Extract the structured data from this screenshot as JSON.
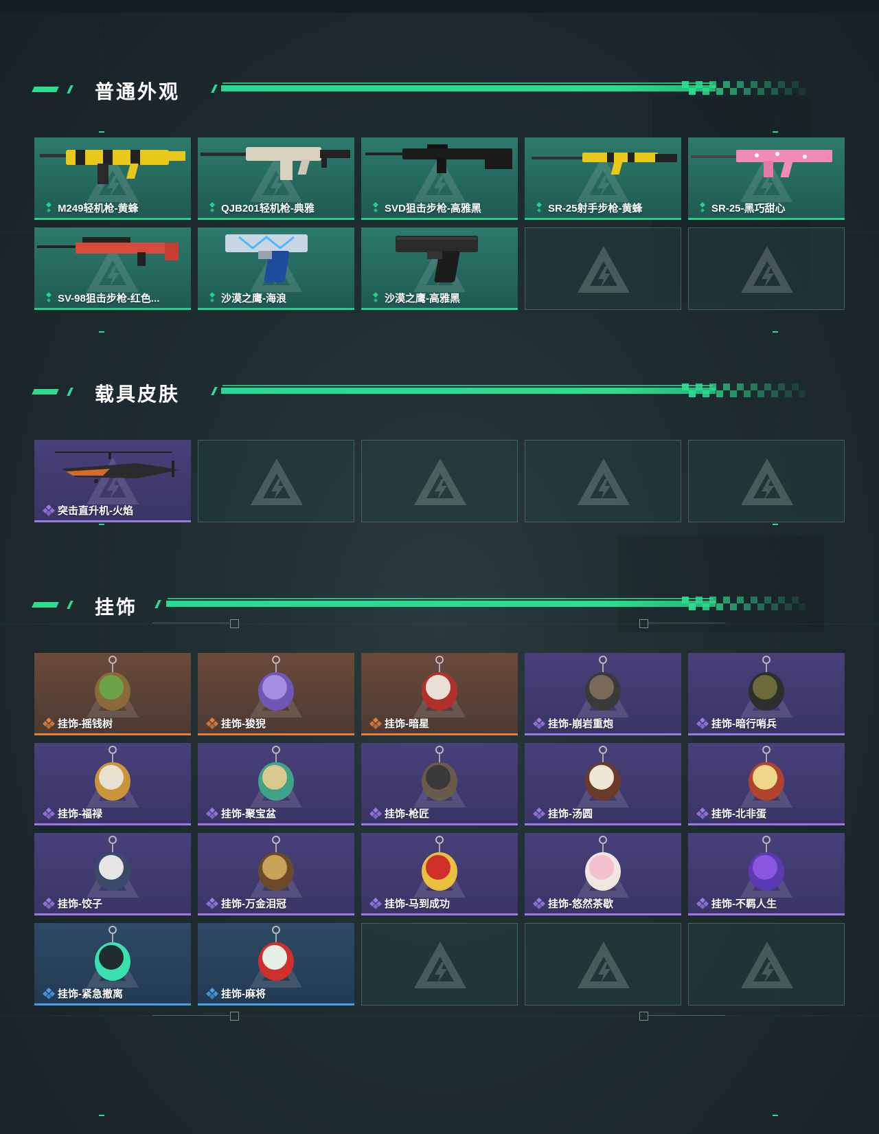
{
  "sections": [
    {
      "title": "普通外观",
      "items": [
        {
          "label": "M249轻机枪-黄蜂",
          "rarity": "green",
          "icon": "machine-gun-icon"
        },
        {
          "label": "QJB201轻机枪-典雅",
          "rarity": "green",
          "icon": "light-machine-gun-icon"
        },
        {
          "label": "SVD狙击步枪-高雅黑",
          "rarity": "green",
          "icon": "sniper-rifle-icon"
        },
        {
          "label": "SR-25射手步枪-黄蜂",
          "rarity": "green",
          "icon": "marksman-rifle-icon"
        },
        {
          "label": "SR-25-黑巧甜心",
          "rarity": "green",
          "icon": "marksman-rifle-pink-icon"
        },
        {
          "label": "SV-98狙击步枪-红色...",
          "rarity": "green",
          "icon": "sniper-rifle-red-icon"
        },
        {
          "label": "沙漠之鹰-海浪",
          "rarity": "green",
          "icon": "pistol-blue-icon"
        },
        {
          "label": "沙漠之鹰-高雅黑",
          "rarity": "green",
          "icon": "pistol-black-icon"
        }
      ],
      "empty_slots": 2
    },
    {
      "title": "载具皮肤",
      "items": [
        {
          "label": "突击直升机-火焰",
          "rarity": "purple",
          "icon": "helicopter-icon"
        }
      ],
      "empty_slots": 4
    },
    {
      "title": "挂饰",
      "items": [
        {
          "label": "挂饰-摇钱树",
          "rarity": "orange",
          "icon": "money-tree-charm-icon"
        },
        {
          "label": "挂饰-狻猊",
          "rarity": "orange",
          "icon": "suanni-charm-icon"
        },
        {
          "label": "挂饰-暗星",
          "rarity": "orange",
          "icon": "dark-star-charm-icon"
        },
        {
          "label": "挂饰-崩岩重炮",
          "rarity": "purple",
          "icon": "rock-cannon-charm-icon"
        },
        {
          "label": "挂饰-暗行哨兵",
          "rarity": "purple",
          "icon": "sentinel-charm-icon"
        },
        {
          "label": "挂饰-福禄",
          "rarity": "purple",
          "icon": "gourd-charm-icon"
        },
        {
          "label": "挂饰-聚宝盆",
          "rarity": "purple",
          "icon": "treasure-bowl-charm-icon"
        },
        {
          "label": "挂饰-枪匠",
          "rarity": "purple",
          "icon": "gunsmith-charm-icon"
        },
        {
          "label": "挂饰-汤圆",
          "rarity": "purple",
          "icon": "tangyuan-charm-icon"
        },
        {
          "label": "挂饰-北非蛋",
          "rarity": "purple",
          "icon": "shakshuka-charm-icon"
        },
        {
          "label": "挂饰-饺子",
          "rarity": "purple",
          "icon": "dumpling-charm-icon"
        },
        {
          "label": "挂饰-万金泪冠",
          "rarity": "purple",
          "icon": "burger-charm-icon"
        },
        {
          "label": "挂饰-马到成功",
          "rarity": "purple",
          "icon": "horse-charm-icon"
        },
        {
          "label": "挂饰-悠然茶歇",
          "rarity": "purple",
          "icon": "cupcake-charm-icon"
        },
        {
          "label": "挂饰-不羁人生",
          "rarity": "purple",
          "icon": "sneaker-charm-icon"
        },
        {
          "label": "挂饰-紧急撤离",
          "rarity": "blue",
          "icon": "evac-charm-icon"
        },
        {
          "label": "挂饰-麻将",
          "rarity": "blue",
          "icon": "mahjong-charm-icon"
        }
      ],
      "empty_slots": 3
    }
  ],
  "colors": {
    "accent": "#2ddc8f",
    "green_rarity": "#27cf8c",
    "purple_rarity": "#9c7ae6",
    "orange_rarity": "#e0813f",
    "blue_rarity": "#4aa0e8"
  }
}
